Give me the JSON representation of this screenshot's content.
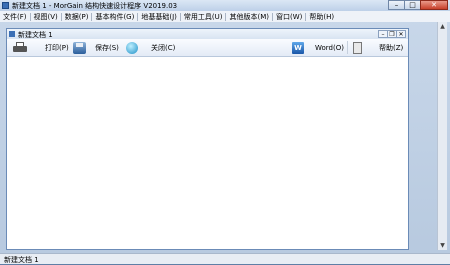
{
  "window": {
    "title": "新建文档 1 - MorGain 结构快速设计程序 V2019.03",
    "controls": {
      "minimize": "–",
      "maximize": "□",
      "close": "✕"
    }
  },
  "menubar": {
    "items": [
      "文件(F)",
      "视图(V)",
      "数据(P)",
      "基本构件(G)",
      "地基基础(J)",
      "常用工具(U)",
      "其他版本(M)",
      "窗口(W)",
      "帮助(H)"
    ]
  },
  "document": {
    "title": "新建文档 1",
    "controls": {
      "minimize": "–",
      "restore": "❐",
      "close": "✕"
    }
  },
  "toolbar": {
    "print_label": "打印(P)",
    "save_label": "保存(S)",
    "close_label": "关闭(C)",
    "word_label": "Word(O)",
    "help_label": "帮助(Z)",
    "word_icon_text": "W"
  },
  "statusbar": {
    "text": "新建文档 1"
  },
  "icons": [
    "app-icon",
    "printer-icon",
    "save-icon",
    "close-icon",
    "word-icon",
    "help-icon"
  ]
}
